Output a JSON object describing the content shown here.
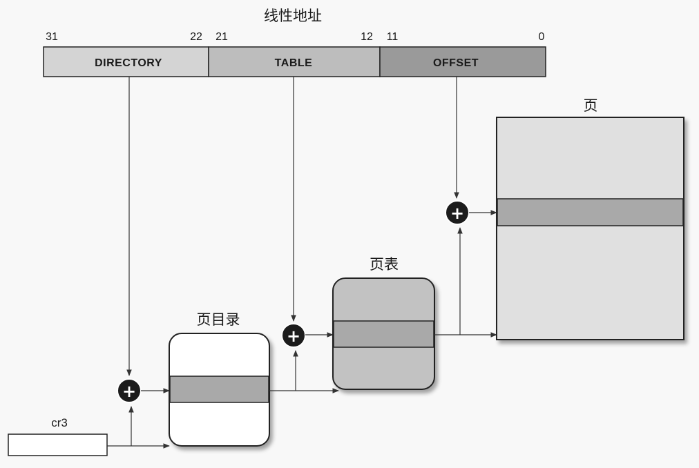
{
  "linear_address": {
    "title": "线性地址",
    "fields": [
      {
        "label": "DIRECTORY",
        "high_bit": "31",
        "low_bit": "22"
      },
      {
        "label": "TABLE",
        "high_bit": "21",
        "low_bit": "12"
      },
      {
        "label": "OFFSET",
        "high_bit": "11",
        "low_bit": "0"
      }
    ]
  },
  "register": {
    "label": "cr3"
  },
  "page_directory": {
    "label": "页目录"
  },
  "page_table": {
    "label": "页表"
  },
  "page": {
    "label": "页"
  },
  "adder_symbol": "+",
  "colors": {
    "directory_field": "#d4d4d4",
    "table_field": "#bdbdbd",
    "offset_field": "#9a9a9a",
    "selected_entry": "#a9a9a9",
    "page_table_fill": "#c2c2c2",
    "page_fill": "#e0e0e0",
    "adder": "#1c1c1c"
  }
}
